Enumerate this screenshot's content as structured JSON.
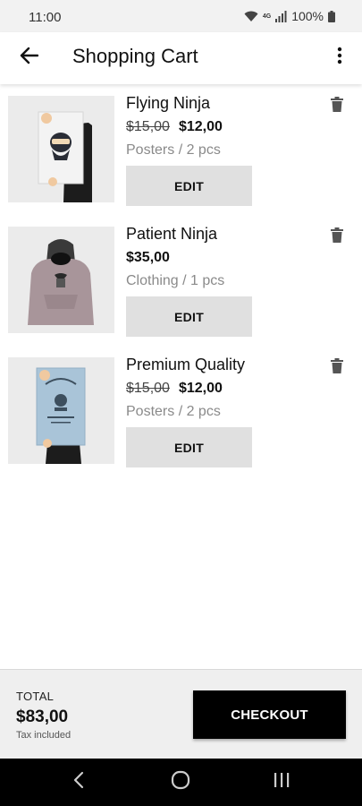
{
  "status_bar": {
    "time": "11:00",
    "network": "4G",
    "battery": "100%",
    "icons": [
      "wifi-icon",
      "signal-icon",
      "battery-icon"
    ]
  },
  "app_bar": {
    "title": "Shopping Cart",
    "back_icon": "arrow-left-icon",
    "menu_icon": "more-vertical-icon"
  },
  "cart": {
    "items": [
      {
        "name": "Flying Ninja",
        "old_price": "$15,00",
        "price": "$12,00",
        "meta": "Posters / 2 pcs",
        "edit_label": "EDIT",
        "image": "poster-ninja"
      },
      {
        "name": "Patient Ninja",
        "old_price": "",
        "price": "$35,00",
        "meta": "Clothing / 1 pcs",
        "edit_label": "EDIT",
        "image": "hoodie"
      },
      {
        "name": "Premium Quality",
        "old_price": "$15,00",
        "price": "$12,00",
        "meta": "Posters / 2 pcs",
        "edit_label": "EDIT",
        "image": "poster-woothemes"
      }
    ]
  },
  "summary": {
    "total_label": "TOTAL",
    "total_value": "$83,00",
    "tax_note": "Tax included",
    "checkout_label": "CHECKOUT"
  },
  "colors": {
    "accent": "#000000",
    "button_bg": "#e0e0e0",
    "meta_text": "#8a8a8a"
  }
}
